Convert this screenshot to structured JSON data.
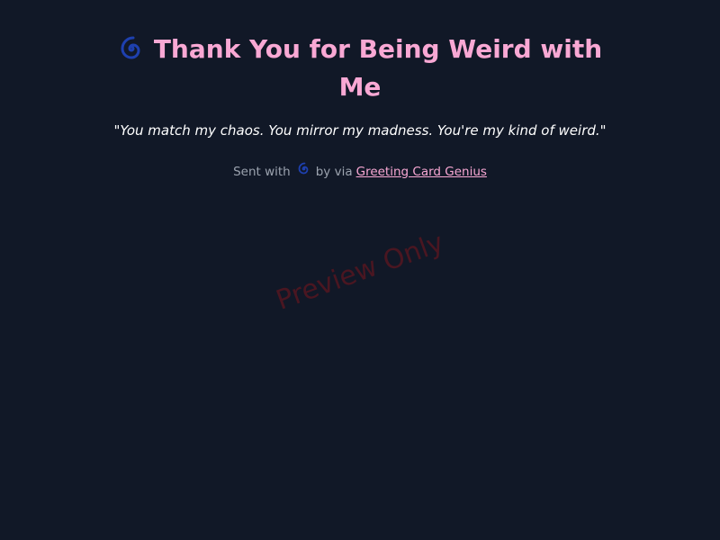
{
  "card": {
    "title": "Thank You for Being Weird with Me",
    "quote": "\"You match my chaos. You mirror my madness. You're my kind of weird.\"",
    "title_icon": "cyclone-icon"
  },
  "footer": {
    "sent_with": "Sent with",
    "icon": "cyclone-icon",
    "by_via": "by via",
    "link_text": "Greeting Card Genius"
  },
  "watermark": {
    "text": "Preview Only"
  },
  "colors": {
    "background": "#111827",
    "title": "#f9a8d4",
    "quote": "#ffffff",
    "footer_text": "#9ca3af",
    "link": "#f9a8d4",
    "icon_blue": "#1e40af",
    "watermark": "#4a1621"
  }
}
